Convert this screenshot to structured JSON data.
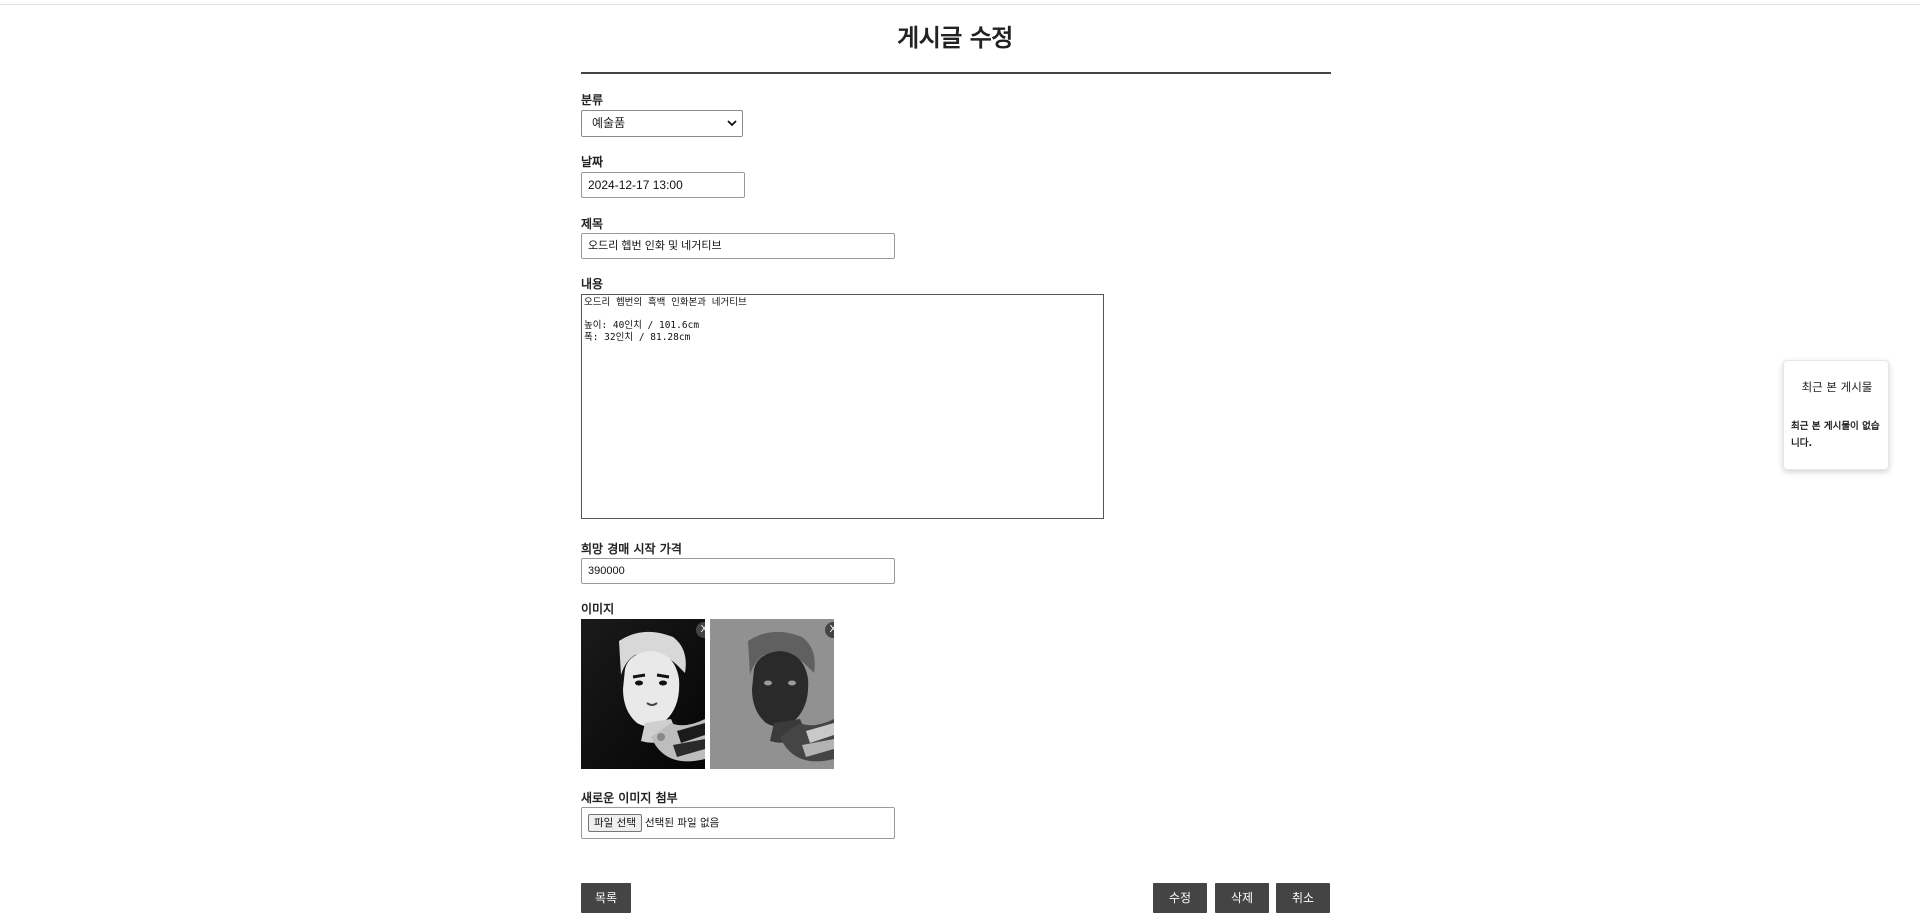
{
  "page": {
    "title": "게시글 수정"
  },
  "form": {
    "category": {
      "label": "분류",
      "value": "예술품"
    },
    "date": {
      "label": "날짜",
      "value": "2024-12-17 13:00"
    },
    "subject": {
      "label": "제목",
      "value": "오드리 헵번 인화 및 네거티브"
    },
    "content": {
      "label": "내용",
      "value": "오드리 헵번의 흑백 인화본과 네거티브\n\n높이: 40인치 / 101.6cm\n폭: 32인치 / 81.28cm"
    },
    "price": {
      "label": "희망 경매 시작 가격",
      "value": "390000"
    },
    "images": {
      "label": "이미지",
      "items": [
        {
          "alt": "audrey-hepburn-print",
          "remove_label": "X"
        },
        {
          "alt": "audrey-hepburn-negative",
          "remove_label": "X"
        }
      ]
    },
    "attach": {
      "label": "새로운 이미지 첨부",
      "button_label": "파일 선택",
      "status": "선택된 파일 없음"
    }
  },
  "actions": {
    "list_label": "목록",
    "edit_label": "수정",
    "delete_label": "삭제",
    "cancel_label": "취소"
  },
  "recent_panel": {
    "title": "최근 본 게시물",
    "empty_text": "최근 본 게시물이 없습니다."
  },
  "icons": {
    "select_arrow": "chevron-down-icon",
    "remove": "close-icon"
  },
  "colors": {
    "button_bg": "#444444",
    "rule": "#444444"
  }
}
